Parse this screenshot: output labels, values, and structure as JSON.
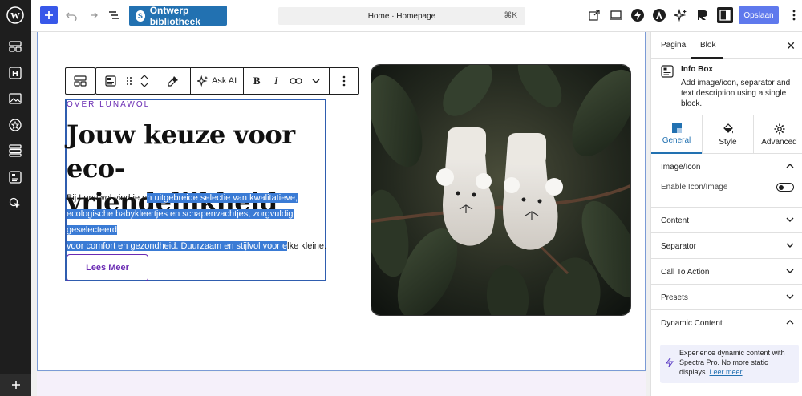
{
  "topbar": {
    "spectra_label": "Ontwerp bibliotheek",
    "command_text": "Home · Homepage",
    "command_shortcut": "⌘K",
    "save_label": "Opslaan"
  },
  "block_toolbar": {
    "ask_ai_label": "Ask AI"
  },
  "content": {
    "eyebrow": "OVER LUNAWOL",
    "heading_line1": "Jouw keuze voor eco-",
    "heading_line2": "vriendelijkheid",
    "desc_part1": "Bij Lunawol vind je e",
    "desc_part2": "n uitgebreide selectie van kwalitatieve,",
    "desc_part3": "ecologische babykleertjes en schapenvachtjes, zorgvuldig geselecteerd",
    "desc_part4": "voor comfort en gezondheid. Duurzaam en stijlvol voor e",
    "desc_part5": "lke kleine.",
    "cta_label": "Lees Meer"
  },
  "panel": {
    "tab_page": "Pagina",
    "tab_block": "Blok",
    "block_title": "Info Box",
    "block_desc": "Add image/icon, separator and text description using a single block.",
    "settings_tabs": [
      "General",
      "Style",
      "Advanced"
    ],
    "sections": {
      "image_icon": "Image/Icon",
      "enable_icon": "Enable Icon/Image",
      "content": "Content",
      "separator": "Separator",
      "cta": "Call To Action",
      "presets": "Presets",
      "dynamic": "Dynamic Content"
    },
    "promo_text": "Experience dynamic content with Spectra Pro. No more static displays.",
    "promo_link": "Leer meer"
  },
  "colors": {
    "accent": "#3858e9",
    "spectra": "#2271b1",
    "brand_purple": "#6a2bb3",
    "selection": "#3a7bd5"
  }
}
